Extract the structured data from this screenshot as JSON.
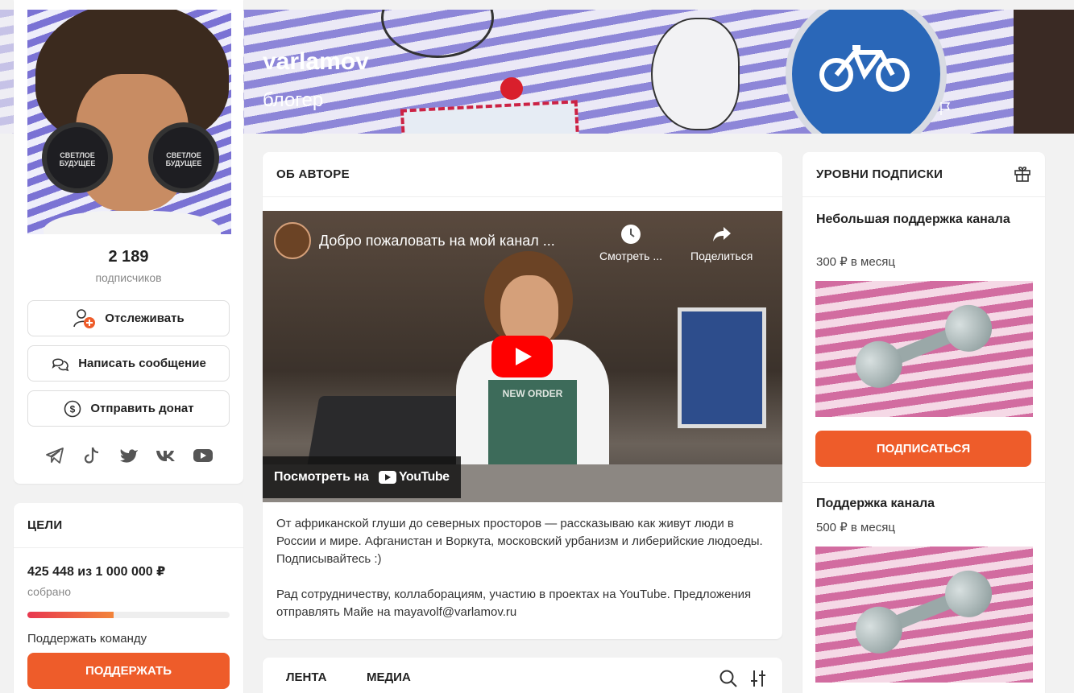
{
  "cover": {
    "name": "varlamov",
    "role": "блогер"
  },
  "profile": {
    "avatar_text_left": "СВЕТЛОЕ БУДУЩЕЕ",
    "avatar_text_right": "СВЕТЛОЕ БУДУЩЕЕ",
    "subscribers_count": "2 189",
    "subscribers_label": "подписчиков",
    "follow_label": "Отслеживать",
    "message_label": "Написать сообщение",
    "donate_label": "Отправить донат",
    "socials": [
      "telegram-icon",
      "tiktok-icon",
      "twitter-icon",
      "vk-icon",
      "youtube-icon"
    ]
  },
  "goals": {
    "title": "ЦЕЛИ",
    "amount": "425 448 из 1 000 000 ₽",
    "collected_label": "собрано",
    "progress": 0.425,
    "note": "Поддержать команду",
    "button_label": "ПОДДЕРЖАТЬ"
  },
  "about": {
    "title": "ОБ АВТОРЕ",
    "video": {
      "title": "Добро пожаловать на мой канал ...",
      "watch_later": "Смотреть ...",
      "share": "Поделиться",
      "watch_on": "Посмотреть на",
      "youtube": "YouTube",
      "shirt_text": "NEW ORDER"
    },
    "paragraph1": "От африканской глуши до северных просторов — рассказываю как живут люди в России и мире. Афганистан и Воркута, московский урбанизм и либерийские людоеды. Подписывайтесь :)",
    "paragraph2": "Рад сотрудничеству, коллаборациям, участию в проектах на YouTube. Предложения отправлять Майе на mayavolf@varlamov.ru"
  },
  "feed": {
    "tabs": [
      "ЛЕНТА",
      "МЕДИА"
    ]
  },
  "levels": {
    "title": "УРОВНИ ПОДПИСКИ",
    "items": [
      {
        "name": "Небольшая поддержка канала",
        "price": "300 ₽ в месяц",
        "button": "ПОДПИСАТЬСЯ"
      },
      {
        "name": "Поддержка канала",
        "price": "500 ₽ в месяц"
      }
    ]
  },
  "colors": {
    "accent": "#ee5c2a",
    "youtube_red": "#ff0000",
    "background": "#f2f2f2"
  }
}
